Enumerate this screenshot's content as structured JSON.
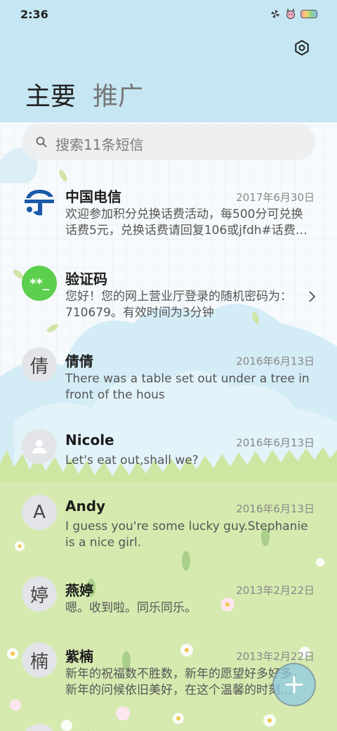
{
  "status_bar": {
    "time": "2:36"
  },
  "header": {
    "tabs": [
      {
        "label": "主要",
        "active": true
      },
      {
        "label": "推广",
        "active": false
      }
    ]
  },
  "search": {
    "placeholder": "搜索11条短信"
  },
  "conversations": [
    {
      "avatar": "china-telecom-logo",
      "name": "中国电信",
      "date": "2017年6月30日",
      "preview": "欢迎参加积分兑换话费活动，每500分可兑换话费5元，兑换话费请回复106或jfdh#话费…"
    },
    {
      "avatar": "**_",
      "name": "验证码",
      "date": "",
      "preview": "您好！您的网上营业厅登录的随机密码为：710679。有效时间为3分钟"
    },
    {
      "avatar": "倩",
      "name": "倩倩",
      "date": "2016年6月13日",
      "preview": "There was a table set out under a tree in front of the hous"
    },
    {
      "avatar": "person-icon",
      "name": "Nicole",
      "date": "2016年6月13日",
      "preview": "Let's eat out,shall we?"
    },
    {
      "avatar": "A",
      "name": "Andy",
      "date": "2016年6月13日",
      "preview": "I guess you're some lucky guy.Stephanie is a nice girl."
    },
    {
      "avatar": "婷",
      "name": "燕婷",
      "date": "2013年2月22日",
      "preview": "嗯。收到啦。同乐同乐。"
    },
    {
      "avatar": "楠",
      "name": "紫楠",
      "date": "2013年2月22日",
      "preview": "新年的祝福数不胜数，新年的愿望好多好多，新年的问候依旧美好，在这个温馨的时刻…"
    },
    {
      "avatar": "",
      "name": "子玲",
      "date": "",
      "preview": ""
    }
  ],
  "colors": {
    "header_bg": "#c5e6f2",
    "verify_avatar": "#5ccf4e",
    "telecom_blue": "#1a5aa8",
    "grass": "#cfe6a2"
  }
}
